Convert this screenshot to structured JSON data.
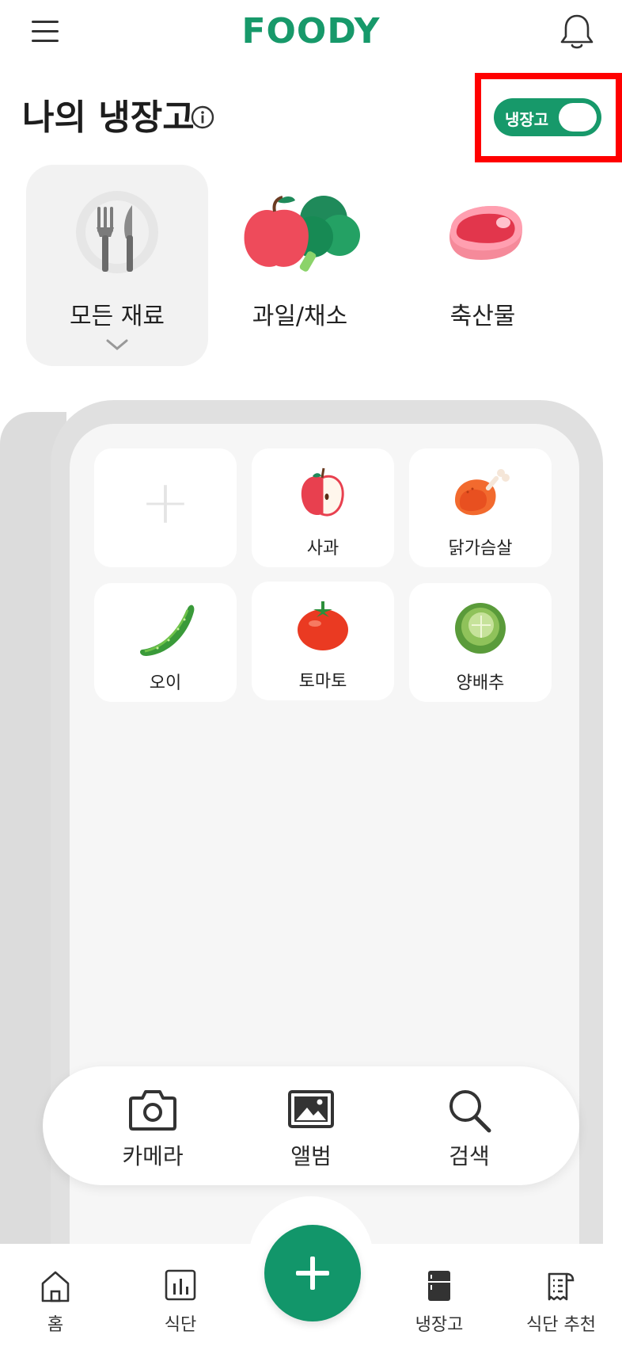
{
  "header": {
    "logo": "FOODY",
    "menu_icon": "hamburger-menu-icon",
    "notification_icon": "bell-icon"
  },
  "title": {
    "text": "나의 냉장고",
    "info_icon": "info-icon"
  },
  "toggle": {
    "label": "냉장고",
    "state": "on"
  },
  "categories": [
    {
      "label": "모든 재료",
      "icon": "fork-knife-icon",
      "selected": true
    },
    {
      "label": "과일/채소",
      "icon": "apple-vegetable-icon",
      "selected": false
    },
    {
      "label": "축산물",
      "icon": "meat-icon",
      "selected": false
    }
  ],
  "fridge": {
    "add_icon": "plus-icon",
    "items": [
      {
        "label": "사과",
        "icon": "apple-icon"
      },
      {
        "label": "닭가슴살",
        "icon": "chicken-icon"
      },
      {
        "label": "오이",
        "icon": "cucumber-icon"
      },
      {
        "label": "토마토",
        "icon": "tomato-icon"
      },
      {
        "label": "양배추",
        "icon": "cabbage-icon"
      }
    ]
  },
  "actions": [
    {
      "label": "카메라",
      "icon": "camera-icon"
    },
    {
      "label": "앨범",
      "icon": "album-icon"
    },
    {
      "label": "검색",
      "icon": "search-icon"
    }
  ],
  "bottom_nav": [
    {
      "label": "홈",
      "icon": "home-icon"
    },
    {
      "label": "식단",
      "icon": "chart-icon"
    },
    {
      "label": "냉장고",
      "icon": "fridge-icon"
    },
    {
      "label": "식단 추천",
      "icon": "receipt-icon"
    }
  ],
  "colors": {
    "brand_green": "#17996a",
    "highlight_red": "#ff0000",
    "fridge_gray": "#e0e0e0"
  }
}
